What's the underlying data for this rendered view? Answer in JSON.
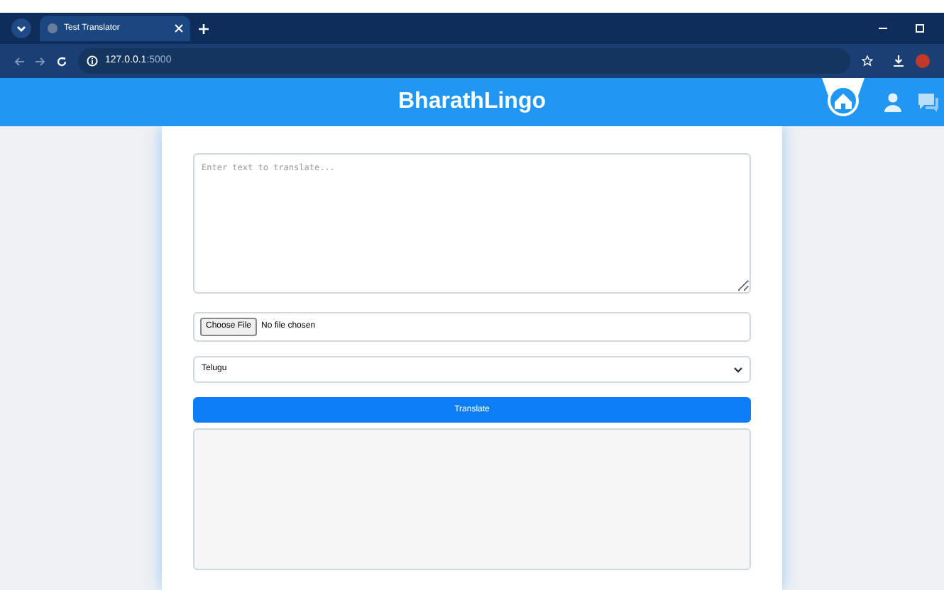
{
  "browser": {
    "tab_title": "Test Translator",
    "url_host": "127.0.0.1",
    "url_port": ":5000"
  },
  "header": {
    "title": "BharathLingo"
  },
  "form": {
    "input_placeholder": "Enter text to translate...",
    "file_button": "Choose File",
    "file_status": "No file chosen",
    "language": "Telugu",
    "submit": "Translate"
  }
}
